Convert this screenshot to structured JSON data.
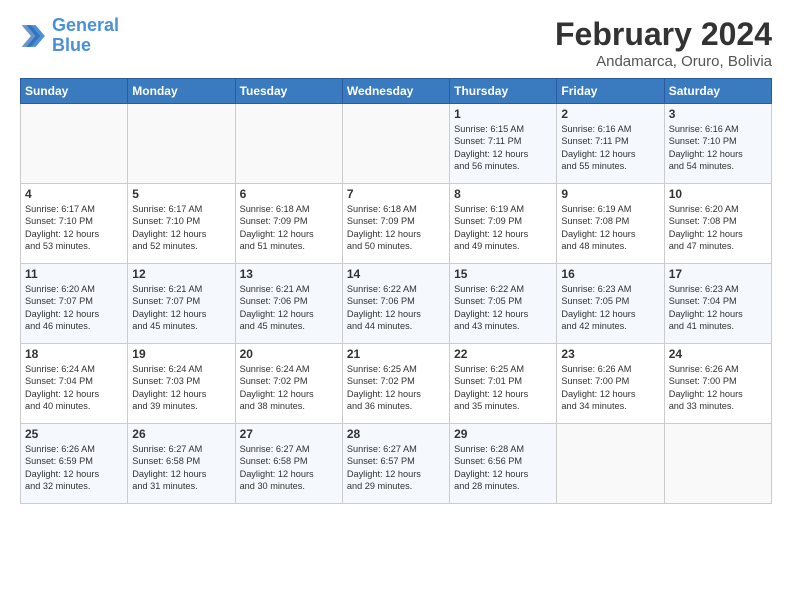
{
  "logo": {
    "line1": "General",
    "line2": "Blue"
  },
  "title": "February 2024",
  "location": "Andamarca, Oruro, Bolivia",
  "days_of_week": [
    "Sunday",
    "Monday",
    "Tuesday",
    "Wednesday",
    "Thursday",
    "Friday",
    "Saturday"
  ],
  "weeks": [
    [
      {
        "day": "",
        "info": ""
      },
      {
        "day": "",
        "info": ""
      },
      {
        "day": "",
        "info": ""
      },
      {
        "day": "",
        "info": ""
      },
      {
        "day": "1",
        "info": "Sunrise: 6:15 AM\nSunset: 7:11 PM\nDaylight: 12 hours\nand 56 minutes."
      },
      {
        "day": "2",
        "info": "Sunrise: 6:16 AM\nSunset: 7:11 PM\nDaylight: 12 hours\nand 55 minutes."
      },
      {
        "day": "3",
        "info": "Sunrise: 6:16 AM\nSunset: 7:10 PM\nDaylight: 12 hours\nand 54 minutes."
      }
    ],
    [
      {
        "day": "4",
        "info": "Sunrise: 6:17 AM\nSunset: 7:10 PM\nDaylight: 12 hours\nand 53 minutes."
      },
      {
        "day": "5",
        "info": "Sunrise: 6:17 AM\nSunset: 7:10 PM\nDaylight: 12 hours\nand 52 minutes."
      },
      {
        "day": "6",
        "info": "Sunrise: 6:18 AM\nSunset: 7:09 PM\nDaylight: 12 hours\nand 51 minutes."
      },
      {
        "day": "7",
        "info": "Sunrise: 6:18 AM\nSunset: 7:09 PM\nDaylight: 12 hours\nand 50 minutes."
      },
      {
        "day": "8",
        "info": "Sunrise: 6:19 AM\nSunset: 7:09 PM\nDaylight: 12 hours\nand 49 minutes."
      },
      {
        "day": "9",
        "info": "Sunrise: 6:19 AM\nSunset: 7:08 PM\nDaylight: 12 hours\nand 48 minutes."
      },
      {
        "day": "10",
        "info": "Sunrise: 6:20 AM\nSunset: 7:08 PM\nDaylight: 12 hours\nand 47 minutes."
      }
    ],
    [
      {
        "day": "11",
        "info": "Sunrise: 6:20 AM\nSunset: 7:07 PM\nDaylight: 12 hours\nand 46 minutes."
      },
      {
        "day": "12",
        "info": "Sunrise: 6:21 AM\nSunset: 7:07 PM\nDaylight: 12 hours\nand 45 minutes."
      },
      {
        "day": "13",
        "info": "Sunrise: 6:21 AM\nSunset: 7:06 PM\nDaylight: 12 hours\nand 45 minutes."
      },
      {
        "day": "14",
        "info": "Sunrise: 6:22 AM\nSunset: 7:06 PM\nDaylight: 12 hours\nand 44 minutes."
      },
      {
        "day": "15",
        "info": "Sunrise: 6:22 AM\nSunset: 7:05 PM\nDaylight: 12 hours\nand 43 minutes."
      },
      {
        "day": "16",
        "info": "Sunrise: 6:23 AM\nSunset: 7:05 PM\nDaylight: 12 hours\nand 42 minutes."
      },
      {
        "day": "17",
        "info": "Sunrise: 6:23 AM\nSunset: 7:04 PM\nDaylight: 12 hours\nand 41 minutes."
      }
    ],
    [
      {
        "day": "18",
        "info": "Sunrise: 6:24 AM\nSunset: 7:04 PM\nDaylight: 12 hours\nand 40 minutes."
      },
      {
        "day": "19",
        "info": "Sunrise: 6:24 AM\nSunset: 7:03 PM\nDaylight: 12 hours\nand 39 minutes."
      },
      {
        "day": "20",
        "info": "Sunrise: 6:24 AM\nSunset: 7:02 PM\nDaylight: 12 hours\nand 38 minutes."
      },
      {
        "day": "21",
        "info": "Sunrise: 6:25 AM\nSunset: 7:02 PM\nDaylight: 12 hours\nand 36 minutes."
      },
      {
        "day": "22",
        "info": "Sunrise: 6:25 AM\nSunset: 7:01 PM\nDaylight: 12 hours\nand 35 minutes."
      },
      {
        "day": "23",
        "info": "Sunrise: 6:26 AM\nSunset: 7:00 PM\nDaylight: 12 hours\nand 34 minutes."
      },
      {
        "day": "24",
        "info": "Sunrise: 6:26 AM\nSunset: 7:00 PM\nDaylight: 12 hours\nand 33 minutes."
      }
    ],
    [
      {
        "day": "25",
        "info": "Sunrise: 6:26 AM\nSunset: 6:59 PM\nDaylight: 12 hours\nand 32 minutes."
      },
      {
        "day": "26",
        "info": "Sunrise: 6:27 AM\nSunset: 6:58 PM\nDaylight: 12 hours\nand 31 minutes."
      },
      {
        "day": "27",
        "info": "Sunrise: 6:27 AM\nSunset: 6:58 PM\nDaylight: 12 hours\nand 30 minutes."
      },
      {
        "day": "28",
        "info": "Sunrise: 6:27 AM\nSunset: 6:57 PM\nDaylight: 12 hours\nand 29 minutes."
      },
      {
        "day": "29",
        "info": "Sunrise: 6:28 AM\nSunset: 6:56 PM\nDaylight: 12 hours\nand 28 minutes."
      },
      {
        "day": "",
        "info": ""
      },
      {
        "day": "",
        "info": ""
      }
    ]
  ]
}
